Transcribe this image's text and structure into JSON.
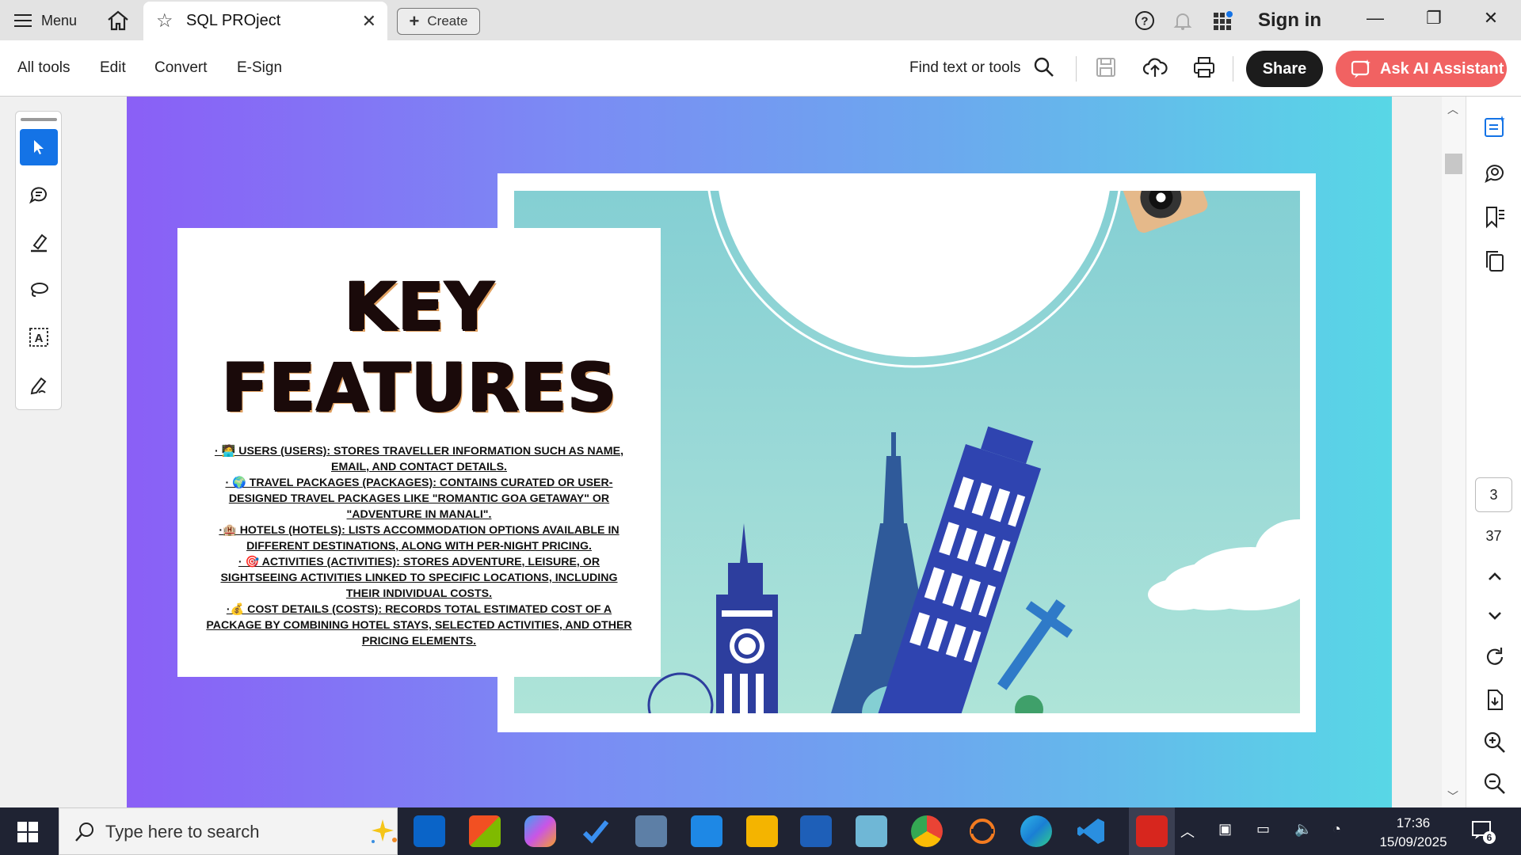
{
  "tabbar": {
    "menu_label": "Menu",
    "tab_title": "SQL PROject",
    "create_label": "Create",
    "signin_label": "Sign in"
  },
  "toolbar": {
    "menu_items": [
      "All tools",
      "Edit",
      "Convert",
      "E-Sign"
    ],
    "find_label": "Find text or tools",
    "share_label": "Share",
    "ai_label": "Ask AI Assistant"
  },
  "document": {
    "heading_line1": "KEY",
    "heading_line2": "FEATURES",
    "features": [
      "· 🧑‍💻 USERS (USERS): STORES TRAVELLER INFORMATION SUCH AS NAME, EMAIL, AND CONTACT DETAILS.",
      "· 🌍 TRAVEL PACKAGES (PACKAGES): CONTAINS CURATED OR USER-DESIGNED TRAVEL PACKAGES LIKE \"ROMANTIC GOA GETAWAY\" OR \"ADVENTURE IN MANALI\".",
      "·🏨 HOTELS (HOTELS): LISTS ACCOMMODATION OPTIONS AVAILABLE IN DIFFERENT DESTINATIONS, ALONG WITH PER-NIGHT PRICING.",
      "· 🎯 ACTIVITIES (ACTIVITIES): STORES ADVENTURE, LEISURE, OR SIGHTSEEING ACTIVITIES LINKED TO SPECIFIC LOCATIONS, INCLUDING THEIR INDIVIDUAL COSTS.",
      "·💰 COST DETAILS (COSTS): RECORDS TOTAL ESTIMATED COST OF A PACKAGE BY COMBINING HOTEL STAYS, SELECTED ACTIVITIES, AND OTHER PRICING ELEMENTS."
    ]
  },
  "navigation": {
    "current_page": "3",
    "total_pages": "37"
  },
  "taskbar": {
    "search_placeholder": "Type here to search",
    "time": "17:36",
    "date": "15/09/2025",
    "notification_count": "6"
  },
  "colors": {
    "accent_blue": "#1473e6",
    "ai_button": "#f16262",
    "share_button": "#1c1c1c",
    "taskbar": "#1f2333"
  }
}
